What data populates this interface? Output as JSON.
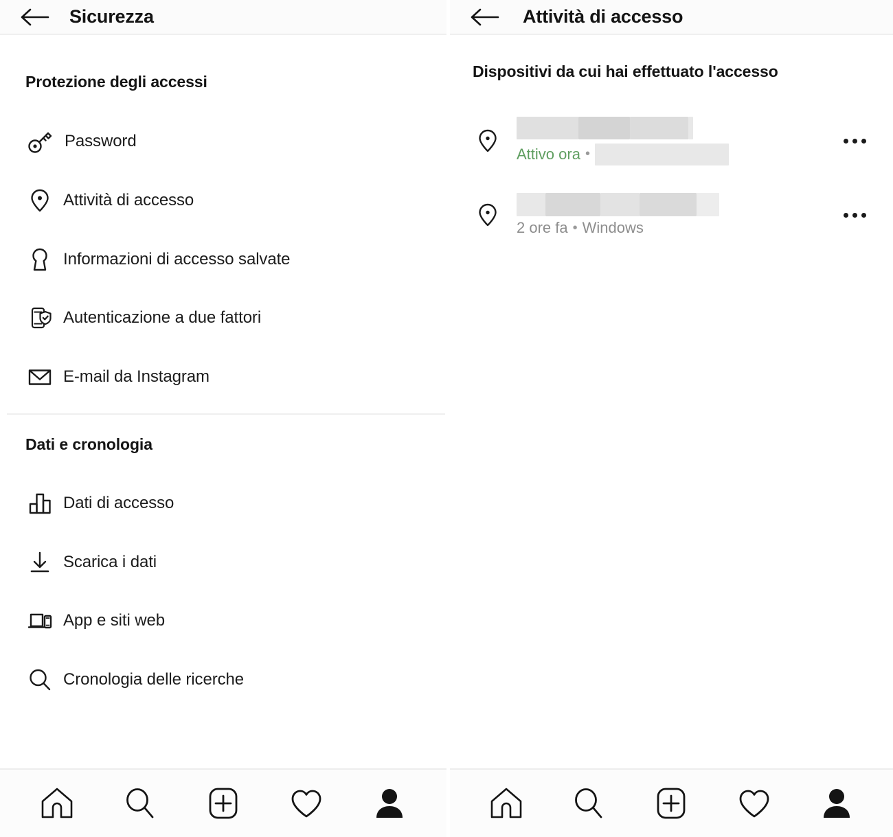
{
  "screens": [
    {
      "id": "security",
      "header": {
        "title": "Sicurezza",
        "back_icon": "back-arrow-icon"
      },
      "sections": [
        {
          "heading": "Protezione degli accessi",
          "items": [
            {
              "label": "Password",
              "icon": "key-icon"
            },
            {
              "label": "Attività di accesso",
              "icon": "location-pin-icon"
            },
            {
              "label": "Informazioni di accesso salvate",
              "icon": "keyhole-icon"
            },
            {
              "label": "Autenticazione a due fattori",
              "icon": "phone-shield-icon"
            },
            {
              "label": "E-mail da Instagram",
              "icon": "envelope-icon"
            }
          ]
        },
        {
          "heading": "Dati e cronologia",
          "items": [
            {
              "label": "Dati di accesso",
              "icon": "bar-chart-icon"
            },
            {
              "label": "Scarica i dati",
              "icon": "download-icon"
            },
            {
              "label": "App e siti web",
              "icon": "laptop-phone-icon"
            },
            {
              "label": "Cronologia delle ricerche",
              "icon": "search-icon"
            }
          ]
        }
      ]
    },
    {
      "id": "login-activity",
      "header": {
        "title": "Attività di accesso",
        "back_icon": "back-arrow-icon"
      },
      "heading": "Dispositivi da cui hai effettuato l'accesso",
      "devices": [
        {
          "icon": "location-pin-icon",
          "name_redacted": true,
          "status": "Attivo ora",
          "status_color": "#5f9e60",
          "separator": "•",
          "detail_redacted": true,
          "menu_icon": "more-options-icon"
        },
        {
          "icon": "location-pin-icon",
          "name_redacted": true,
          "time": "2 ore fa",
          "separator": "•",
          "platform": "Windows",
          "menu_icon": "more-options-icon"
        }
      ]
    }
  ],
  "bottom_nav": {
    "items": [
      {
        "name": "home",
        "icon": "home-icon"
      },
      {
        "name": "search",
        "icon": "search-icon"
      },
      {
        "name": "create",
        "icon": "plus-square-icon"
      },
      {
        "name": "activity",
        "icon": "heart-icon"
      },
      {
        "name": "profile",
        "icon": "person-filled-icon"
      }
    ]
  },
  "colors": {
    "background": "#ffffff",
    "header_bg": "#fbfbfb",
    "border": "#efefef",
    "text_primary": "#1a1a1a",
    "text_secondary": "#8e8e8e",
    "active_green": "#5f9e60",
    "redaction": "#dcdcdc"
  }
}
